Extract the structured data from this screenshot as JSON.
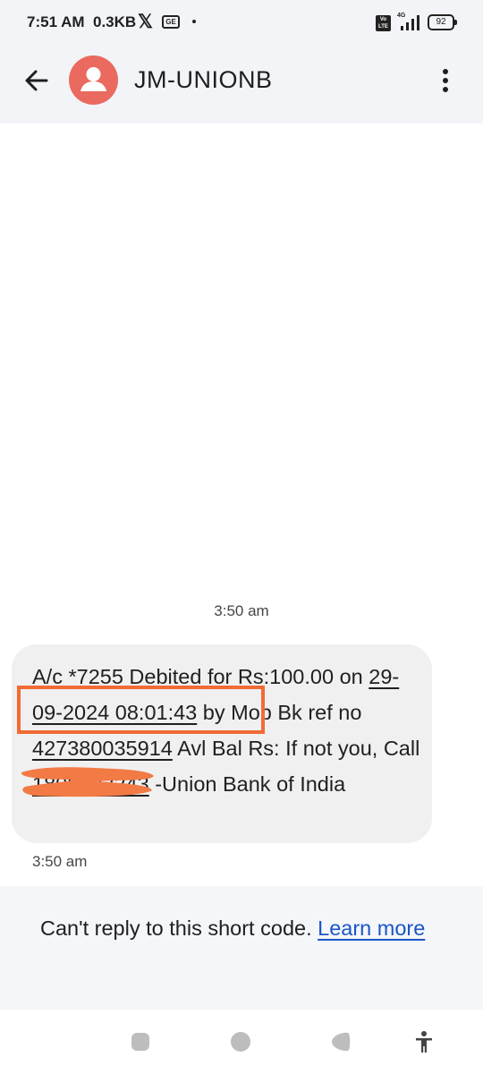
{
  "status_bar": {
    "time": "7:51 AM",
    "data_speed": "0.3KB",
    "x_glyph": "𝕏",
    "ge_label": "GE",
    "volte_label": "Vo LTE",
    "network": "4G",
    "battery": "92"
  },
  "app_bar": {
    "title": "JM-UNIONB",
    "back_icon": "arrow-left-icon",
    "avatar_icon": "person-icon",
    "menu_icon": "more-vertical-icon"
  },
  "conversation": {
    "date_timestamp": "3:50 am",
    "message": {
      "part1": "A/c *7255 Debited for Rs:100.00 on ",
      "datetime": "29-09-2024 08:01:43",
      "part2": " by Mob Bk ref no ",
      "ref_no": "427380035914",
      "part3": " Avl Bal Rs: ",
      "part4": " If not you, Call ",
      "phone": "1800222243",
      "part5": " -Union Bank of India"
    },
    "message_time": "3:50 am"
  },
  "footer": {
    "text": "Can't reply to this short code. ",
    "link": "Learn more"
  },
  "colors": {
    "highlight": "#f26b34",
    "redaction": "#f27a45",
    "avatar": "#ea6a5f",
    "link": "#1a56c4"
  }
}
